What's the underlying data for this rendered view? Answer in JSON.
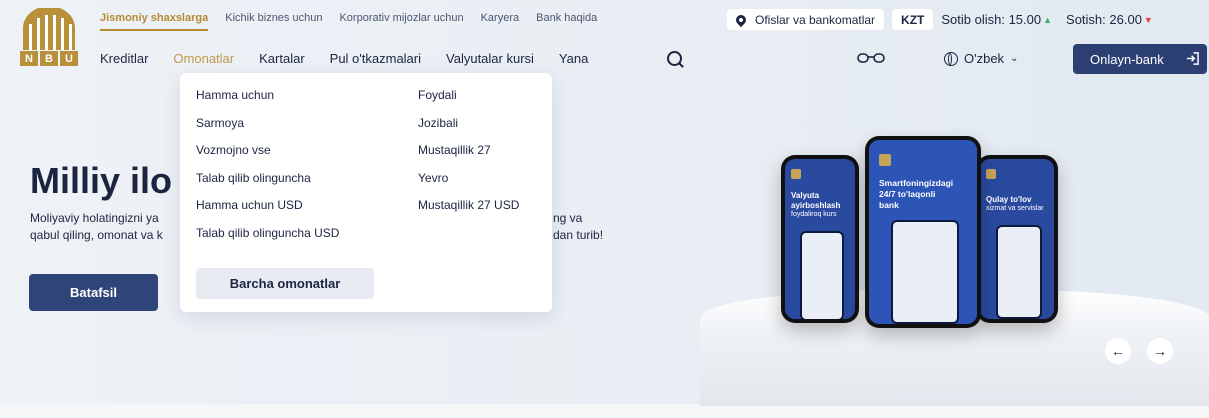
{
  "logo": {
    "letters": [
      "N",
      "B",
      "U"
    ]
  },
  "top_nav": [
    {
      "label": "Jismoniy shaxslarga",
      "active": true
    },
    {
      "label": "Kichik biznes uchun"
    },
    {
      "label": "Korporativ mijozlar uchun"
    },
    {
      "label": "Karyera"
    },
    {
      "label": "Bank haqida"
    }
  ],
  "header": {
    "offices_label": "Ofislar va bankomatlar",
    "currency": "KZT",
    "buy_label": "Sotib olish: 15.00",
    "sell_label": "Sotish: 26.00"
  },
  "main_nav": [
    {
      "label": "Kreditlar"
    },
    {
      "label": "Omonatlar",
      "active": true
    },
    {
      "label": "Kartalar"
    },
    {
      "label": "Pul o'tkazmalari"
    },
    {
      "label": "Valyutalar kursi"
    },
    {
      "label": "Yana"
    }
  ],
  "lang": "O'zbek",
  "online_bank": "Onlayn-bank",
  "dropdown": {
    "left": [
      "Hamma uchun",
      "Sarmoya",
      "Vozmojno vse",
      "Talab qilib olinguncha",
      "Hamma uchun USD",
      "Talab qilib olinguncha USD"
    ],
    "right": [
      "Foydali",
      "Jozibali",
      "Mustaqillik 27",
      "Yevro",
      "Mustaqillik 27 USD"
    ],
    "all_button": "Barcha omonatlar"
  },
  "hero": {
    "title": "Milliy ilo",
    "line1": "Moliyaviy holatingizni ya",
    "line2": "qabul qiling, omonat va k",
    "line1_tail": "ng va",
    "line2_tail": "dan turib!",
    "button": "Batafsil"
  },
  "phones": {
    "left": {
      "line1": "Valyuta",
      "line2": "ayirboshlash",
      "line3": "foydaliroq kurs"
    },
    "center": {
      "line1": "Smartfoningizdagi",
      "line2": "24/7 to'laqonli",
      "line3": "bank"
    },
    "right": {
      "line1": "Qulay to'lov",
      "line2": "xizmat va servislar"
    }
  },
  "colors": {
    "brand_gold": "#b68b33",
    "brand_navy": "#2c3f73",
    "up": "#2bb673",
    "down": "#e5403a"
  }
}
